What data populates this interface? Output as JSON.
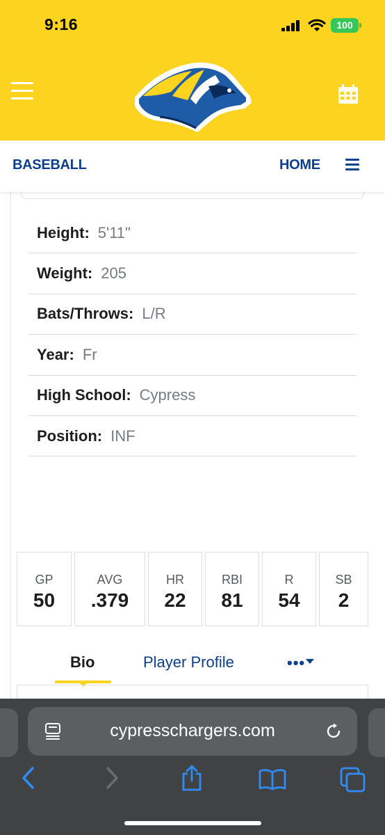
{
  "status_bar": {
    "time": "9:16",
    "battery": "100"
  },
  "header": {
    "logo": "chargers-horse-logo",
    "menu_icon": "hamburger-menu-icon",
    "calendar_icon": "calendar-icon",
    "colors": {
      "background": "#fcd31f",
      "brand_blue": "#0d3f8c"
    }
  },
  "nav": {
    "sport": "BASEBALL",
    "home": "HOME"
  },
  "player_info": [
    {
      "label": "Height:",
      "value": "5'11\""
    },
    {
      "label": "Weight:",
      "value": "205"
    },
    {
      "label": "Bats/Throws:",
      "value": "L/R"
    },
    {
      "label": "Year:",
      "value": "Fr"
    },
    {
      "label": "High School:",
      "value": "Cypress"
    },
    {
      "label": "Position:",
      "value": "INF"
    }
  ],
  "stats": [
    {
      "label": "GP",
      "value": "50"
    },
    {
      "label": "AVG",
      "value": ".379"
    },
    {
      "label": "HR",
      "value": "22"
    },
    {
      "label": "RBI",
      "value": "81"
    },
    {
      "label": "R",
      "value": "54"
    },
    {
      "label": "SB",
      "value": "2"
    }
  ],
  "tabs": {
    "bio": "Bio",
    "profile": "Player Profile",
    "more": "•••"
  },
  "browser": {
    "url": "cypresschargers.com"
  }
}
